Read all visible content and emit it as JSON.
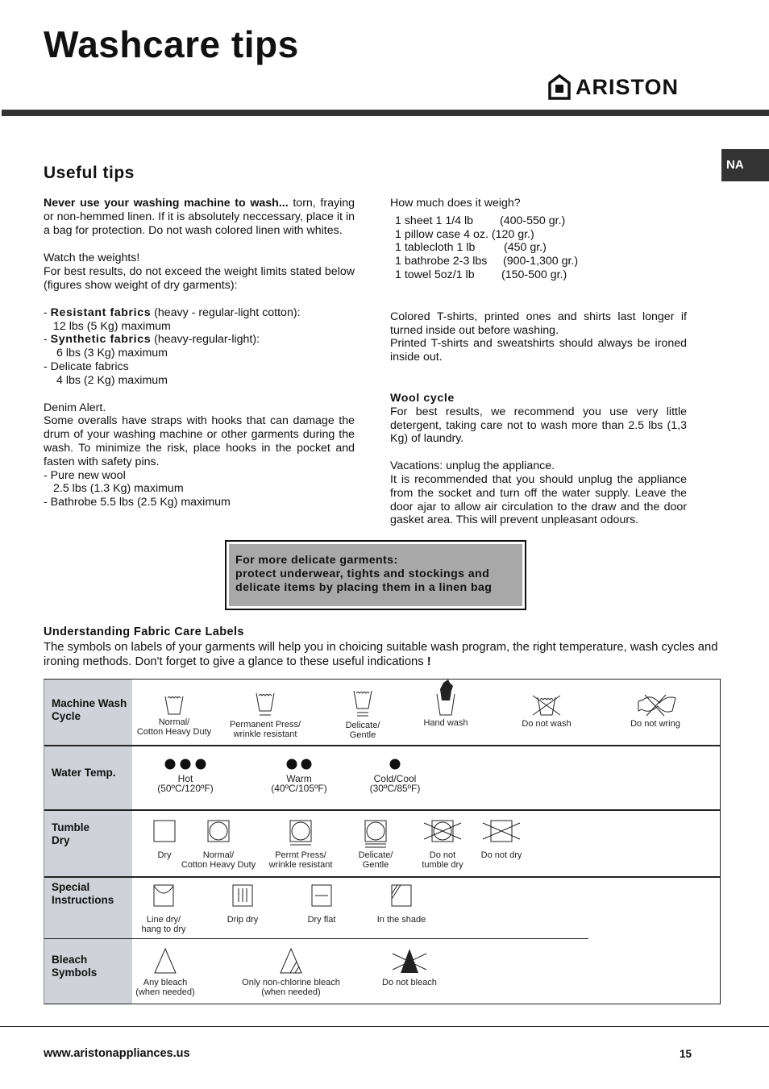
{
  "header": {
    "title": "Washcare tips",
    "brand": "ARISTON",
    "region_tab": "NA"
  },
  "section_title": "Useful  tips",
  "left": {
    "p1_bold": "Never use your washing machine to wash...",
    "p1_rest": " torn, fraying or non-hemmed linen. If it is absolutely neccessary, place it in a bag for protection. Do not wash colored linen with whites.",
    "weights_title": "Watch the weights!",
    "weights_text": "For best results, do not exceed the weight limits stated below (figures show weight of dry garments):",
    "limits": [
      {
        "name": "Resistant fabrics",
        "desc": " (heavy - regular-light cotton):",
        "value": "12 lbs  (5 Kg) maximum"
      },
      {
        "name": "Synthetic fabrics",
        "desc": " (heavy-regular-light):",
        "value": "6 lbs (3 Kg) maximum"
      },
      {
        "name": "Delicate fabrics",
        "desc": "",
        "value": "4 lbs (2 Kg) maximum"
      }
    ],
    "denim_title": "Denim Alert.",
    "denim_text": "Some overalls have straps with hooks that can damage the drum of your washing machine or other garments during the wash. To minimize the risk, place hooks in the pocket and fasten with safety pins.",
    "wool_name": "Pure new wool",
    "wool_value": "2.5 lbs (1.3 Kg) maximum",
    "bathrobe_name": "Bathrobe",
    "bathrobe_value": " 5.5 lbs (2.5 Kg)  maximum"
  },
  "right": {
    "weigh_title": "How much does it weigh?",
    "weigh_items": [
      {
        "item": "1 sheet 1 1/4 lb",
        "grams": "(400-550 gr.)"
      },
      {
        "item": "1 pillow case  4 oz",
        "grams": ". (120 gr.)"
      },
      {
        "item": "1 tablecloth 1 lb",
        "grams": "(450 gr.)"
      },
      {
        "item": "1 bathrobe 2-3 lbs",
        "grams": "(900-1,300 gr.)"
      },
      {
        "item": "1 towel 5oz/1 lb",
        "grams": "(150-500 gr.)"
      }
    ],
    "tshirts_text": "Colored T-shirts, printed ones and shirts last longer if turned inside out before washing.",
    "tshirts_text2": "Printed T-shirts and sweatshirts should always be ironed inside out.",
    "wool_title": "Wool  cycle",
    "wool_text": "For best results, we recommend you use very little detergent, taking care not to wash more than 2.5 lbs (1,3 Kg) of laundry.",
    "vac_title": "Vacations: unplug the appliance.",
    "vac_text": "It is recommended that you should unplug the appliance from the socket and turn off the water supply. Leave the door ajar to allow air circulation to the draw and the door gasket area. This will prevent unpleasant odours."
  },
  "notice": {
    "line1": "For more delicate garments:",
    "line2": "protect underwear, tights and stockings and delicate items by placing them in a linen bag"
  },
  "fabric_care": {
    "title": "Understanding Fabric Care Labels",
    "text": "The symbols on labels of your garments will help you in choicing suitable wash program, the right temperature, wash cycles and ironing  methods. Don't forget to give a glance to these useful indications ",
    "exclaim": "!"
  },
  "table": {
    "rows": [
      {
        "label": "Machine Wash\nCycle",
        "items": [
          {
            "label": "Normal/\nCotton Heavy Duty",
            "icon": "wash-tub-icon"
          },
          {
            "label": "Permanent Press/\nwrinkle resistant",
            "icon": "wash-tub-one-bar-icon"
          },
          {
            "label": "Delicate/\nGentle",
            "icon": "wash-tub-two-bars-icon"
          },
          {
            "label": "Hand wash",
            "icon": "hand-wash-icon"
          },
          {
            "label": "Do not wash",
            "icon": "crossed-wash-tub-icon"
          },
          {
            "label": "Do not wring",
            "icon": "crossed-wring-icon"
          }
        ]
      },
      {
        "label": "Water Temp.",
        "items": [
          {
            "label": "Hot\n(50ºC/120ºF)",
            "icon": "three-dots-icon"
          },
          {
            "label": "Warm\n(40ºC/105ºF)",
            "icon": "two-dots-icon"
          },
          {
            "label": "Cold/Cool\n(30ºC/85ºF)",
            "icon": "one-dot-icon"
          }
        ]
      },
      {
        "label": "Tumble\nDry",
        "items": [
          {
            "label": "Dry",
            "icon": "square-icon"
          },
          {
            "label": "Normal/\nCotton Heavy Duty",
            "icon": "tumble-dry-icon"
          },
          {
            "label": "Permt Press/\nwrinkle resistant",
            "icon": "tumble-dry-one-bar-icon"
          },
          {
            "label": "Delicate/\nGentle",
            "icon": "tumble-dry-two-bars-icon"
          },
          {
            "label": "Do not\ntumble dry",
            "icon": "crossed-tumble-dry-icon"
          },
          {
            "label": "Do not dry",
            "icon": "crossed-square-icon"
          }
        ]
      },
      {
        "label": "Special\nInstructions",
        "items": [
          {
            "label": "Line dry/\nhang to dry",
            "icon": "line-dry-icon"
          },
          {
            "label": "Drip dry",
            "icon": "drip-dry-icon"
          },
          {
            "label": "Dry flat",
            "icon": "dry-flat-icon"
          },
          {
            "label": "In the shade",
            "icon": "shade-dry-icon"
          }
        ]
      },
      {
        "label": "Bleach\nSymbols",
        "items": [
          {
            "label": "Any bleach\n(when needed)",
            "icon": "triangle-icon"
          },
          {
            "label": "Only non-chlorine bleach\n(when needed)",
            "icon": "striped-triangle-icon"
          },
          {
            "label": "Do not bleach",
            "icon": "crossed-triangle-icon"
          }
        ]
      }
    ]
  },
  "footer": {
    "url": "www.aristonappliances.us",
    "page": "15"
  }
}
